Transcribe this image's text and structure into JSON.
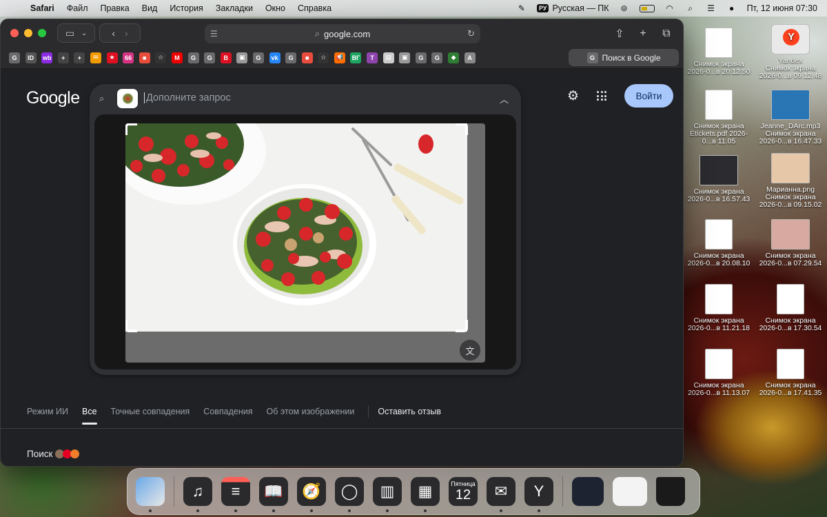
{
  "menubar": {
    "app": "Safari",
    "items": [
      "Файл",
      "Правка",
      "Вид",
      "История",
      "Закладки",
      "Окно",
      "Справка"
    ],
    "lang_badge": "РУ",
    "lang": "Русская — ПК",
    "datetime": "Пт, 12 июня  07:30"
  },
  "browser": {
    "address": "google.com",
    "active_tab": "Поиск в Google",
    "favorites": [
      "G",
      "ID",
      "wb",
      "+",
      "+",
      "✉",
      "★",
      "66",
      "■",
      "☆",
      "M",
      "G",
      "G",
      "B",
      "▣",
      "G",
      "vk",
      "G",
      "■",
      "☆",
      "📢",
      "ВГ",
      "T",
      "▤",
      "▣",
      "G",
      "G",
      "◆",
      "A"
    ]
  },
  "page": {
    "logo": "Google",
    "search_placeholder": "Дополните запрос",
    "signin": "Войти",
    "tabs": [
      "Режим ИИ",
      "Все",
      "Точные совпадения",
      "Совпадения",
      "Об этом изображении"
    ],
    "active_tab_index": 1,
    "feedback": "Оставить отзыв",
    "poisk_label": "Поиск"
  },
  "desktop": {
    "icons": [
      {
        "l1": "Снимок экрана",
        "l2": "2026-0...в 20.12.50",
        "style": "doc"
      },
      {
        "l1": "Yandex",
        "l2": "Снимок экрана 2026-0...в 09.12.48",
        "style": "yandex"
      },
      {
        "l1": "Снимок экрана",
        "l2": "Etickets.pdf 2026-0...в 11.05",
        "style": "doc"
      },
      {
        "l1": "Jeanne_DArc.mp3",
        "l2": "Снимок экрана 2026-0...в 16.47.33",
        "style": "blue"
      },
      {
        "l1": "Снимок экрана",
        "l2": "2026-0...в 16.57.43",
        "style": "dark"
      },
      {
        "l1": "Марианна.png",
        "l2": "Снимок экрана 2026-0...в 09.15.02",
        "style": "photo2"
      },
      {
        "l1": "Снимок экрана",
        "l2": "2026-0...в 20.08.10",
        "style": "doc"
      },
      {
        "l1": "Снимок экрана",
        "l2": "2026-0...в 07.29.54",
        "style": "pink"
      },
      {
        "l1": "Снимок экрана",
        "l2": "2026-0...в 11.21.18",
        "style": "doc"
      },
      {
        "l1": "Снимок экрана",
        "l2": "2026-0...в 17.30.54",
        "style": "doc"
      },
      {
        "l1": "Снимок экрана",
        "l2": "2026-0...в 11.13.07",
        "style": "doc"
      },
      {
        "l1": "Снимок экрана",
        "l2": "2026-0...в 17.41.35",
        "style": "doc"
      }
    ]
  },
  "dock": {
    "calendar_day": "Пятница",
    "calendar_date": "12"
  }
}
